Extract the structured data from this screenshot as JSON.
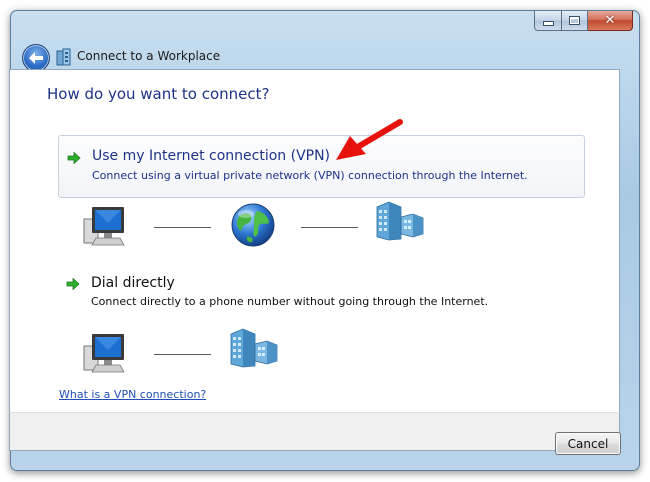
{
  "window": {
    "title": "Connect to a Workplace",
    "buttons": {
      "minimize_icon": "minimize-icon",
      "maximize_icon": "maximize-icon",
      "close_label": "✕"
    }
  },
  "main": {
    "heading": "How do you want to connect?",
    "options": [
      {
        "title": "Use my Internet connection (VPN)",
        "description": "Connect using a virtual private network (VPN) connection through the Internet.",
        "icon": "green-arrow-icon",
        "diagram": [
          "computer-icon",
          "globe-icon",
          "server-building-icon"
        ]
      },
      {
        "title": "Dial directly",
        "description": "Connect directly to a phone number without going through the Internet.",
        "icon": "green-arrow-icon",
        "diagram": [
          "computer-icon",
          "server-building-icon"
        ]
      }
    ],
    "help_link": "What is a VPN connection?"
  },
  "footer": {
    "cancel_label": "Cancel"
  },
  "annotation": {
    "icon": "red-arrow-icon",
    "color": "#e8120c"
  },
  "colors": {
    "heading": "#1e3287",
    "link": "#1f4fb5",
    "window_frame": "#a9c9e3"
  }
}
